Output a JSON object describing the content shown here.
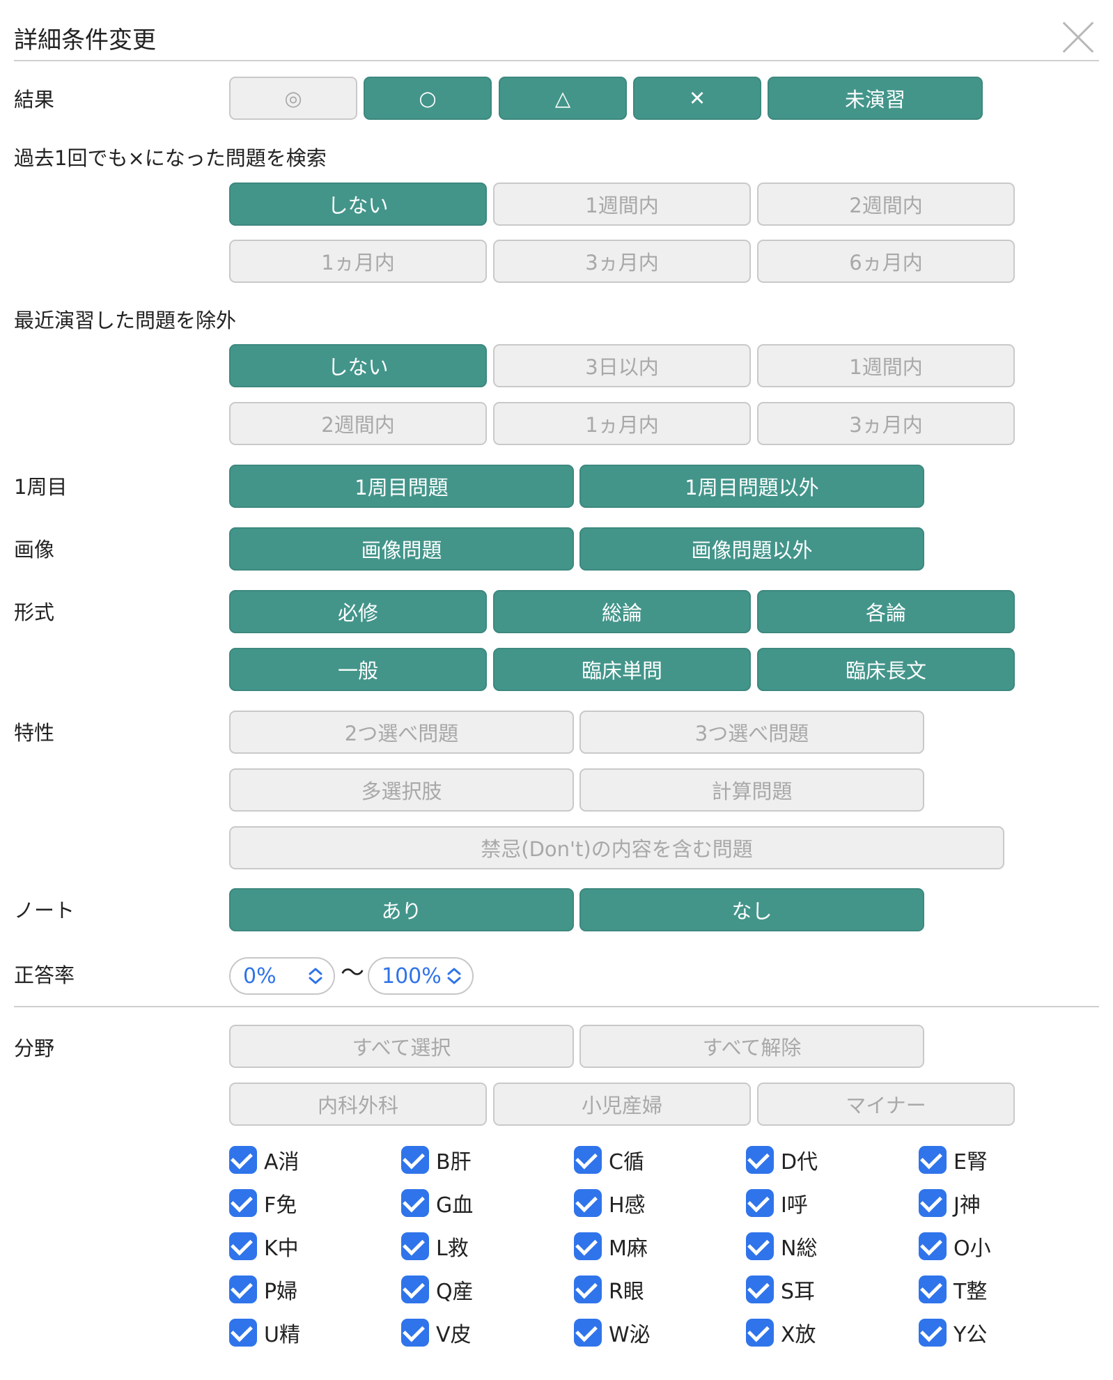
{
  "header": {
    "title": "詳細条件変更"
  },
  "result": {
    "label": "結果",
    "options": [
      "◎",
      "○",
      "△",
      "✕",
      "未演習"
    ]
  },
  "past_wrong": {
    "label": "過去1回でも×になった問題を検索",
    "options": [
      "しない",
      "1週間内",
      "2週間内",
      "1ヵ月内",
      "3ヵ月内",
      "6ヵ月内"
    ]
  },
  "exclude_recent": {
    "label": "最近演習した問題を除外",
    "options": [
      "しない",
      "3日以内",
      "1週間内",
      "2週間内",
      "1ヵ月内",
      "3ヵ月内"
    ]
  },
  "first_round": {
    "label": "1周目",
    "options": [
      "1周目問題",
      "1周目問題以外"
    ]
  },
  "image": {
    "label": "画像",
    "options": [
      "画像問題",
      "画像問題以外"
    ]
  },
  "format": {
    "label": "形式",
    "options": [
      "必修",
      "総論",
      "各論",
      "一般",
      "臨床単問",
      "臨床長文"
    ]
  },
  "traits": {
    "label": "特性",
    "options": [
      "2つ選べ問題",
      "3つ選べ問題",
      "多選択肢",
      "計算問題",
      "禁忌(Don't)の内容を含む問題"
    ]
  },
  "note": {
    "label": "ノート",
    "options": [
      "あり",
      "なし"
    ]
  },
  "accuracy": {
    "label": "正答率",
    "min": "0%",
    "tilde": "〜",
    "max": "100%"
  },
  "fields": {
    "label": "分野",
    "select_all": "すべて選択",
    "deselect_all": "すべて解除",
    "groups": [
      "内科外科",
      "小児産婦",
      "マイナー"
    ],
    "items": [
      "A消",
      "B肝",
      "C循",
      "D代",
      "E腎",
      "F免",
      "G血",
      "H感",
      "I呼",
      "J神",
      "K中",
      "L救",
      "M麻",
      "N総",
      "O小",
      "P婦",
      "Q産",
      "R眼",
      "S耳",
      "T整",
      "U精",
      "V皮",
      "W泌",
      "X放",
      "Y公"
    ]
  },
  "colors": {
    "accent": "#43958a",
    "checkbox": "#2f74ea",
    "inactive": "#efefef"
  }
}
